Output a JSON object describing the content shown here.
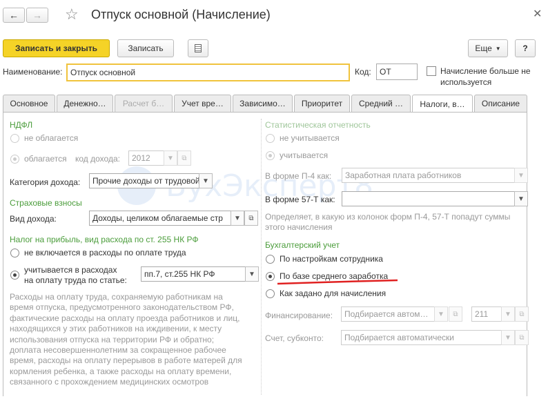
{
  "window": {
    "title": "Отпуск основной (Начисление)"
  },
  "toolbar": {
    "save_close": "Записать и закрыть",
    "save": "Записать",
    "more": "Еще",
    "help": "?"
  },
  "header": {
    "name_label": "Наименование:",
    "name_value": "Отпуск основной",
    "code_label": "Код:",
    "code_value": "ОТ",
    "unused_label_1": "Начисление больше не",
    "unused_label_2": "используется"
  },
  "tabs": [
    {
      "label": "Основное"
    },
    {
      "label": "Денежно…"
    },
    {
      "label": "Расчет б…"
    },
    {
      "label": "Учет вре…"
    },
    {
      "label": "Зависимо…"
    },
    {
      "label": "Приоритет"
    },
    {
      "label": "Средний …"
    },
    {
      "label": "Налоги, в…"
    },
    {
      "label": "Описание"
    }
  ],
  "left": {
    "ndfl_title": "НДФЛ",
    "ndfl_not_taxed": "не облагается",
    "ndfl_taxed": "облагается",
    "income_code_label": "код дохода:",
    "income_code_value": "2012",
    "income_category_label": "Категория дохода:",
    "income_category_value": "Прочие доходы от трудовой",
    "insurance_title": "Страховые взносы",
    "income_type_label": "Вид дохода:",
    "income_type_value": "Доходы, целиком облагаемые стр",
    "profit_title": "Налог на прибыль, вид расхода по ст. 255 НК РФ",
    "profit_not_included": "не включается в расходы по оплате труда",
    "profit_included_1": "учитывается в расходах",
    "profit_included_2": "на оплату труда по статье:",
    "article_value": "пп.7, ст.255 НК РФ",
    "description": [
      "Расходы на оплату труда, сохраняемую работникам на",
      "время отпуска, предусмотренного законодательством РФ,",
      "фактические расходы на оплату проезда работников и лиц,",
      "находящихся у этих работников на иждивении, к месту",
      "использования отпуска на территории РФ и обратно;",
      "доплата несовершеннолетним за сокращенное рабочее",
      "время, расходы на оплату перерывов в работе матерей для",
      "кормления ребенка, а также расходы на оплату времени,",
      "связанного с прохождением медицинских осмотров"
    ]
  },
  "right": {
    "stat_title": "Статистическая отчетность",
    "stat_not_counted": "не учитывается",
    "stat_counted": "учитывается",
    "p4_label": "В форме П-4 как:",
    "p4_value": "Заработная плата работников",
    "t57_label": "В форме 57-Т как:",
    "t57_value": "",
    "stat_hint_1": "Определяет, в какую из колонок форм П-4, 57-Т попадут суммы",
    "stat_hint_2": "этого начисления",
    "acc_title": "Бухгалтерский учет",
    "acc_opt1": "По настройкам сотрудника",
    "acc_opt2": "По базе среднего заработка",
    "acc_opt3": "Как задано для начисления",
    "fin_label": "Финансирование:",
    "fin_value": "Подбирается автом…",
    "fin_code": "211",
    "account_label": "Счет, субконто:",
    "account_value": "Подбирается автоматически"
  },
  "watermark": "БухЭксперт8",
  "colors": {
    "primary_button": "#f5d327",
    "name_field_border": "#f0c33c",
    "section_green": "#4a9c3a",
    "annotation_red": "#e02020"
  }
}
